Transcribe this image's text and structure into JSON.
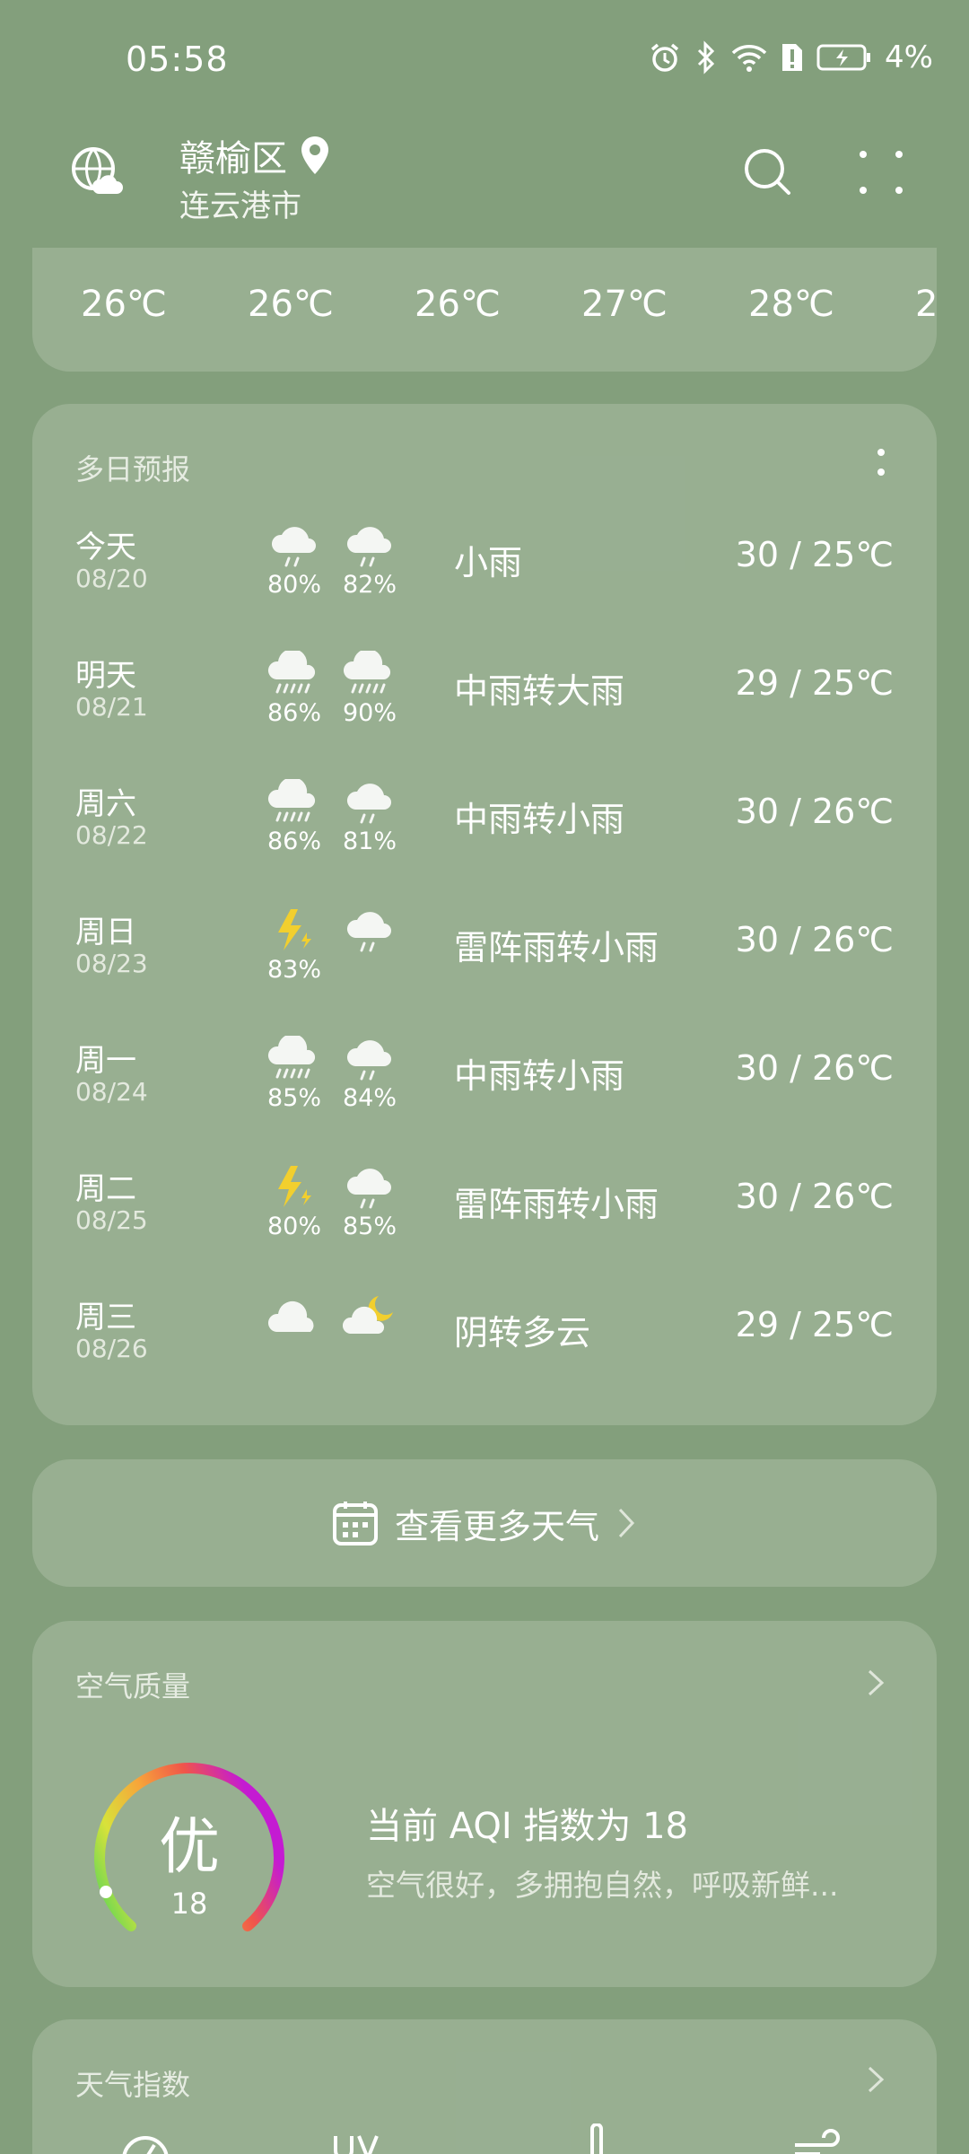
{
  "status": {
    "time": "05:58",
    "battery": "4%"
  },
  "header": {
    "district": "赣榆区",
    "city": "连云港市"
  },
  "hourly": {
    "temps": [
      "26℃",
      "26℃",
      "26℃",
      "27℃",
      "28℃",
      "2"
    ]
  },
  "forecast": {
    "title": "多日预报",
    "rows": [
      {
        "day": "今天",
        "date": "08/20",
        "icon1": "rain-cloud-icon",
        "p1": "80%",
        "icon2": "rain-cloud-icon",
        "p2": "82%",
        "desc": "小雨",
        "range": "30 / 25℃"
      },
      {
        "day": "明天",
        "date": "08/21",
        "icon1": "heavy-rain-cloud-icon",
        "p1": "86%",
        "icon2": "heavy-rain-cloud-icon",
        "p2": "90%",
        "desc": "中雨转大雨",
        "range": "29 / 25℃"
      },
      {
        "day": "周六",
        "date": "08/22",
        "icon1": "heavy-rain-cloud-icon",
        "p1": "86%",
        "icon2": "rain-cloud-icon",
        "p2": "81%",
        "desc": "中雨转小雨",
        "range": "30 / 26℃"
      },
      {
        "day": "周日",
        "date": "08/23",
        "icon1": "thunder-icon",
        "p1": "83%",
        "icon2": "rain-cloud-icon",
        "p2": "",
        "desc": "雷阵雨转小雨",
        "range": "30 / 26℃"
      },
      {
        "day": "周一",
        "date": "08/24",
        "icon1": "heavy-rain-cloud-icon",
        "p1": "85%",
        "icon2": "rain-cloud-icon",
        "p2": "84%",
        "desc": "中雨转小雨",
        "range": "30 / 26℃"
      },
      {
        "day": "周二",
        "date": "08/25",
        "icon1": "thunder-icon",
        "p1": "80%",
        "icon2": "rain-cloud-icon",
        "p2": "85%",
        "desc": "雷阵雨转小雨",
        "range": "30 / 26℃"
      },
      {
        "day": "周三",
        "date": "08/26",
        "icon1": "cloud-icon",
        "p1": "",
        "icon2": "moon-cloud-icon",
        "p2": "",
        "desc": "阴转多云",
        "range": "29 / 25℃"
      }
    ]
  },
  "more_weather": {
    "label": "查看更多天气"
  },
  "aqi": {
    "title": "空气质量",
    "level": "优",
    "value": "18",
    "headline": "当前 AQI 指数为 18",
    "detail": "空气很好，多拥抱自然，呼吸新鲜..."
  },
  "weather_index": {
    "title": "天气指数"
  }
}
